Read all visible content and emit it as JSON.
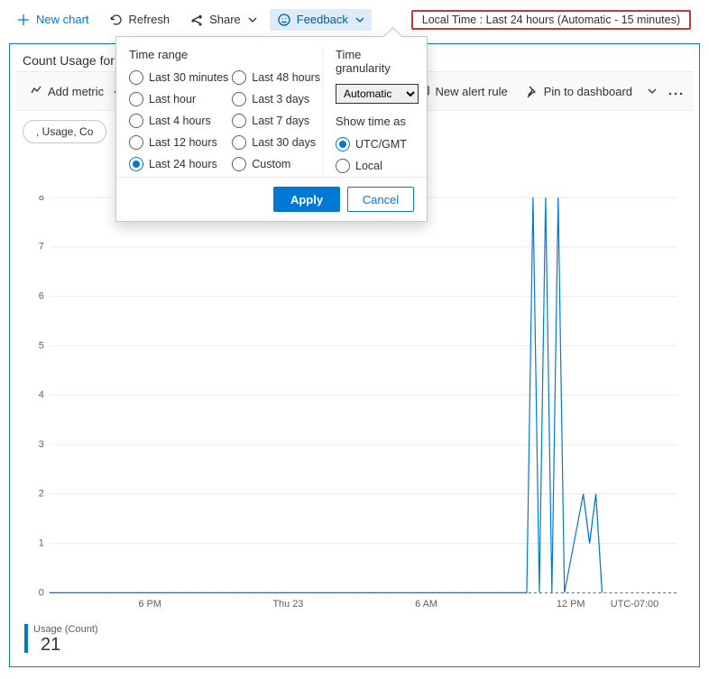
{
  "toolbar": {
    "new_chart_label": "New chart",
    "refresh_label": "Refresh",
    "share_label": "Share",
    "feedback_label": "Feedback",
    "time_pill_text": "Local Time : Last 24 hours (Automatic - 15 minutes)"
  },
  "card": {
    "title": "Count Usage for"
  },
  "chart_toolbar": {
    "add_metric_label": "Add metric",
    "new_alert_rule_label": "New alert rule",
    "pin_to_dashboard_label": "Pin to dashboard"
  },
  "filter_chip": {
    "text": ", Usage, Co"
  },
  "popover": {
    "time_range_heading": "Time range",
    "time_granularity_heading": "Time granularity",
    "show_time_as_heading": "Show time as",
    "granularity_value": "Automatic",
    "apply_label": "Apply",
    "cancel_label": "Cancel",
    "range_options_left": [
      "Last 30 minutes",
      "Last hour",
      "Last 4 hours",
      "Last 12 hours",
      "Last 24 hours"
    ],
    "range_options_right": [
      "Last 48 hours",
      "Last 3 days",
      "Last 7 days",
      "Last 30 days",
      "Custom"
    ],
    "range_selected": "Last 24 hours",
    "show_time_options": [
      "UTC/GMT",
      "Local"
    ],
    "show_time_selected": "UTC/GMT"
  },
  "legend": {
    "label": "Usage (Count)",
    "value": "21"
  },
  "chart_data": {
    "type": "line",
    "title": "Count Usage",
    "ylabel": "Usage (Count)",
    "ylim": [
      0,
      8
    ],
    "y_ticks": [
      0,
      1,
      2,
      3,
      4,
      5,
      6,
      7,
      8
    ],
    "x_ticks": [
      "6 PM",
      "Thu 23",
      "6 AM",
      "12 PM",
      "UTC-07:00"
    ],
    "series": [
      {
        "name": "Usage (Count)",
        "color": "#0078d4",
        "points": [
          {
            "x_pct": 0,
            "y": 0
          },
          {
            "x_pct": 76,
            "y": 0
          },
          {
            "x_pct": 77,
            "y": 8
          },
          {
            "x_pct": 78,
            "y": 0
          },
          {
            "x_pct": 79,
            "y": 8
          },
          {
            "x_pct": 80,
            "y": 0
          },
          {
            "x_pct": 81,
            "y": 8
          },
          {
            "x_pct": 82,
            "y": 0
          },
          {
            "x_pct": 85,
            "y": 2
          },
          {
            "x_pct": 86,
            "y": 1
          },
          {
            "x_pct": 87,
            "y": 2
          },
          {
            "x_pct": 88,
            "y": 0
          }
        ]
      }
    ]
  }
}
